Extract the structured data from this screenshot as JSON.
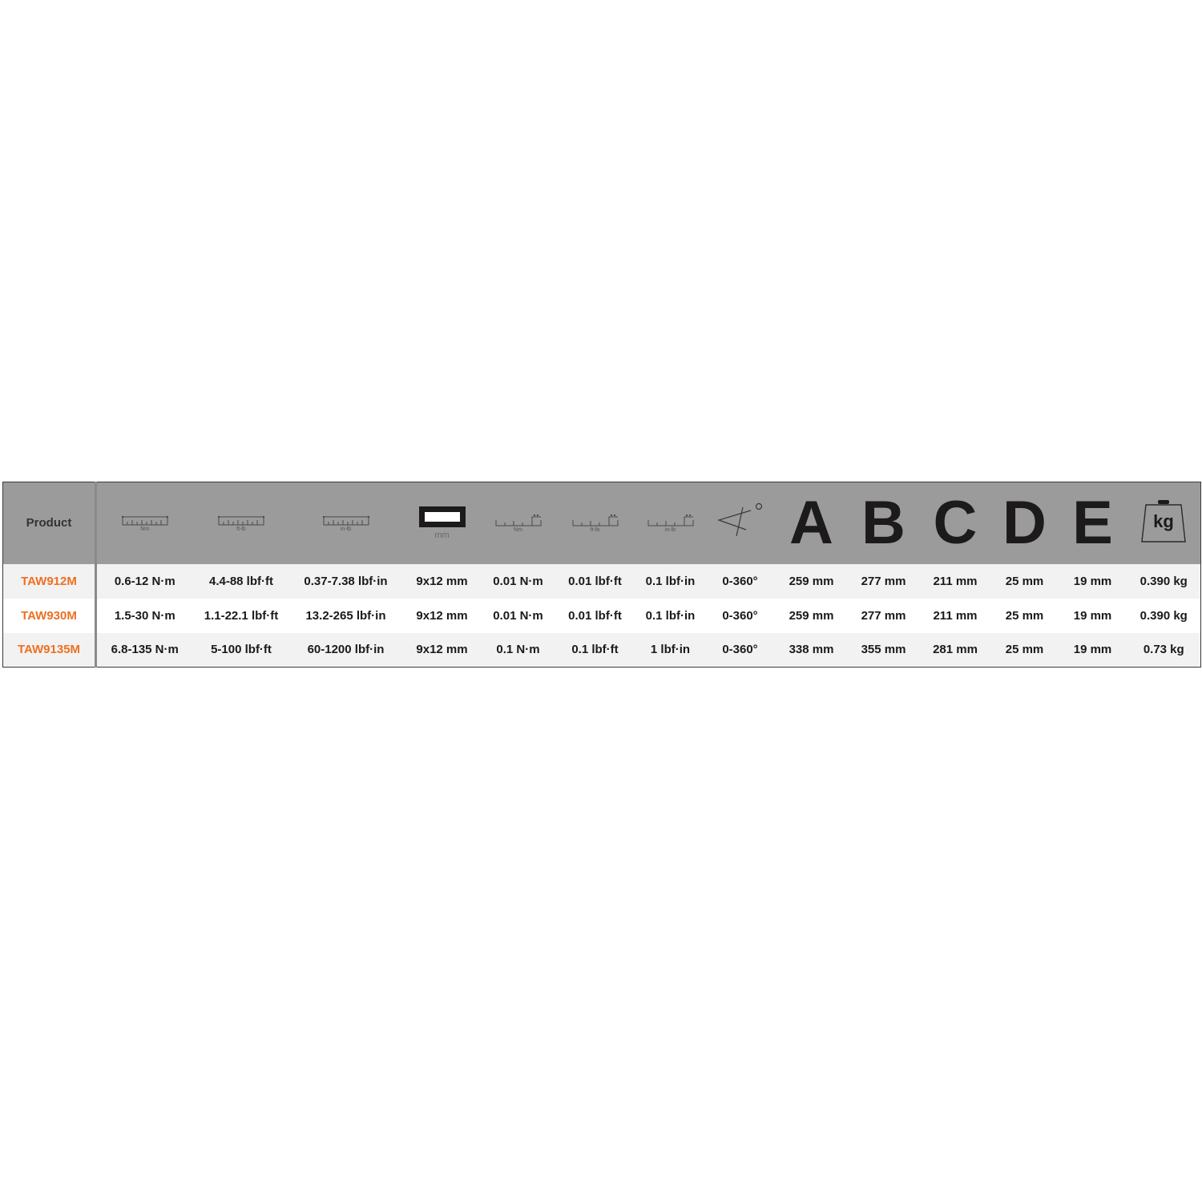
{
  "table": {
    "header": {
      "product_label": "Product",
      "columns": [
        {
          "icon": "torque-scale-icon",
          "sub": "Nm"
        },
        {
          "icon": "torque-scale-icon",
          "sub": "ft-lb"
        },
        {
          "icon": "torque-scale-icon",
          "sub": "in-lb"
        },
        {
          "icon": "square-drive-icon",
          "sub": "mm"
        },
        {
          "icon": "resolution-scale-icon",
          "sub": "Nm"
        },
        {
          "icon": "resolution-scale-icon",
          "sub": "ft-lb"
        },
        {
          "icon": "resolution-scale-icon",
          "sub": "in-lb"
        },
        {
          "icon": "angle-icon",
          "sub": "°"
        },
        {
          "icon": "dimension-letter",
          "letter": "A"
        },
        {
          "icon": "dimension-letter",
          "letter": "B"
        },
        {
          "icon": "dimension-letter",
          "letter": "C"
        },
        {
          "icon": "dimension-letter",
          "letter": "D"
        },
        {
          "icon": "dimension-letter",
          "letter": "E"
        },
        {
          "icon": "weight-icon",
          "label": "kg"
        }
      ]
    },
    "rows": [
      {
        "product": "TAW912M",
        "cells": [
          "0.6-12 N·m",
          "4.4-88 lbf·ft",
          "0.37-7.38 lbf·in",
          "9x12 mm",
          "0.01 N·m",
          "0.01 lbf·ft",
          "0.1 lbf·in",
          "0-360°",
          "259 mm",
          "277 mm",
          "211 mm",
          "25 mm",
          "19 mm",
          "0.390 kg"
        ]
      },
      {
        "product": "TAW930M",
        "cells": [
          "1.5-30 N·m",
          "1.1-22.1 lbf·ft",
          "13.2-265 lbf·in",
          "9x12 mm",
          "0.01 N·m",
          "0.01 lbf·ft",
          "0.1 lbf·in",
          "0-360°",
          "259 mm",
          "277 mm",
          "211 mm",
          "25 mm",
          "19 mm",
          "0.390 kg"
        ]
      },
      {
        "product": "TAW9135M",
        "cells": [
          "6.8-135 N·m",
          "5-100 lbf·ft",
          "60-1200 lbf·in",
          "9x12 mm",
          "0.1 N·m",
          "0.1 lbf·ft",
          "1 lbf·in",
          "0-360°",
          "338 mm",
          "355 mm",
          "281 mm",
          "25 mm",
          "19 mm",
          "0.73 kg"
        ]
      }
    ],
    "colors": {
      "product_accent": "#ee6f22",
      "header_bg": "#9b9b9b",
      "row_alt_bg": "#f2f2f2"
    }
  }
}
